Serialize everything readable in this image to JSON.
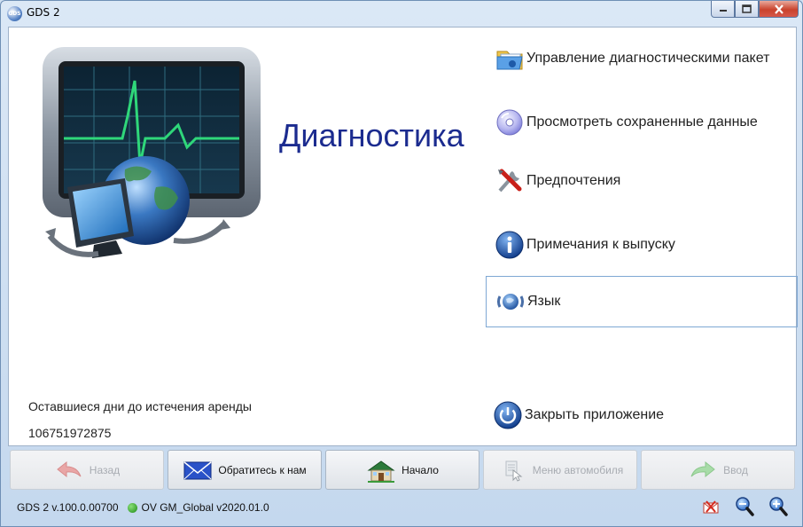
{
  "window": {
    "title": "GDS 2",
    "app_icon_text": "GDS"
  },
  "main": {
    "title": "Диагностика"
  },
  "menu": [
    {
      "label": "Управление диагностическими пакет",
      "icon": "folder-package-icon"
    },
    {
      "label": "Просмотреть сохраненные данные",
      "icon": "disc-icon"
    },
    {
      "label": "Предпочтения",
      "icon": "tools-icon"
    },
    {
      "label": "Примечания к выпуску",
      "icon": "info-icon"
    },
    {
      "label": "Язык",
      "icon": "language-icon",
      "selected": true
    },
    {
      "label": "Закрыть приложение",
      "icon": "power-icon"
    }
  ],
  "lease": {
    "label": "Оставшиеся дни до истечения аренды",
    "value": "106751972875"
  },
  "nav": {
    "back": {
      "label": "Назад",
      "enabled": false
    },
    "contact": {
      "label": "Обратитесь к нам",
      "enabled": true
    },
    "home": {
      "label": "Начало",
      "enabled": true
    },
    "vehicle_menu": {
      "label": "Меню автомобиля",
      "enabled": false
    },
    "enter": {
      "label": "Ввод",
      "enabled": false
    }
  },
  "status": {
    "version": "GDS 2 v.100.0.00700",
    "database": "OV GM_Global v2020.01.0",
    "db_status_color": "#1d8a14"
  },
  "colors": {
    "title": "#1b2b8f",
    "selection_border": "#7fa8d4"
  }
}
